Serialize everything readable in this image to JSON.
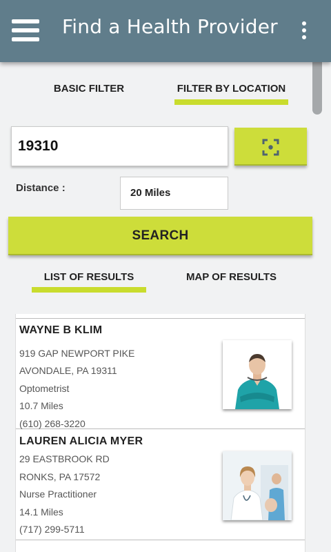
{
  "app": {
    "title": "Find a Health Provider"
  },
  "icons": {
    "menu": "hamburger-menu-icon",
    "overflow": "vertical-dots-icon",
    "locate": "crosshair-locate-icon"
  },
  "filter_tabs": [
    {
      "label": "BASIC FILTER",
      "active": false
    },
    {
      "label": "FILTER BY LOCATION",
      "active": true
    }
  ],
  "location": {
    "zip_value": "19310",
    "distance_label": "Distance :",
    "distance_value": "20 Miles"
  },
  "search": {
    "label": "SEARCH"
  },
  "result_tabs": [
    {
      "label": "LIST OF RESULTS",
      "active": true
    },
    {
      "label": "MAP OF RESULTS",
      "active": false
    }
  ],
  "providers": [
    {
      "name": "WAYNE B KLIM",
      "address1": "919 GAP NEWPORT PIKE",
      "address2": "AVONDALE, PA 19311",
      "specialty": "Optometrist",
      "distance": "10.7 Miles",
      "phone": "(610) 268-3220"
    },
    {
      "name": "LAUREN ALICIA MYER",
      "address1": "29 EASTBROOK RD",
      "address2": "RONKS, PA 17572",
      "specialty": "Nurse Practitioner",
      "distance": "14.1 Miles",
      "phone": "(717) 299-5711"
    }
  ],
  "colors": {
    "appbar": "#607d8b",
    "accent": "#cddd3a",
    "background": "#f1f2f3"
  }
}
